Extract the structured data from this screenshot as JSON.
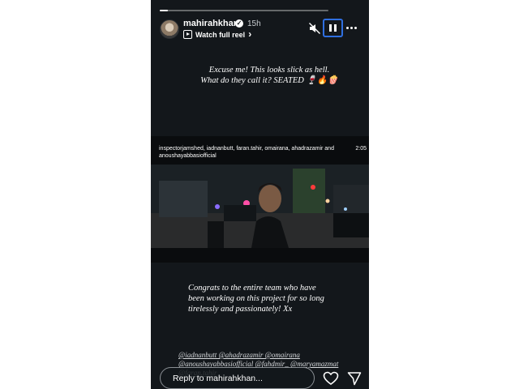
{
  "story": {
    "progress_fraction": 0.05,
    "username": "mahirahkhan",
    "verified_mark": "✓",
    "time_ago": "15h",
    "reel_link_label": "Watch full reel",
    "reel_link_chevron": "›",
    "icons": [
      "mute-icon",
      "pause-icon",
      "more-icon",
      "heart-icon",
      "send-icon",
      "reel-icon",
      "verified-icon"
    ]
  },
  "captions": {
    "top_line1": "Excuse me! This looks slick as hell.",
    "top_line2": "What do they call it? SEATED 🍷🔥🍿",
    "bottom_line1": "Congrats to the entire team who have",
    "bottom_line2": "been working on this project for so long",
    "bottom_line3": "tirelessly and passionately!  Xx"
  },
  "video": {
    "header_line1": "inspectorjamshed, iadnanbutt, faran.tahir, omairana, ahadrazamir and",
    "header_line2": "anoushayabbasiofficial",
    "duration": "2:05"
  },
  "tags": {
    "line1": "@iadnanbutt @ahadrazamir @omairana",
    "line2": "@anoushayabbasiofficial @fahdmir_ @maryamazmat",
    "line3": "@faran.tahir"
  },
  "reply": {
    "placeholder": "Reply to mahirahkhan..."
  }
}
